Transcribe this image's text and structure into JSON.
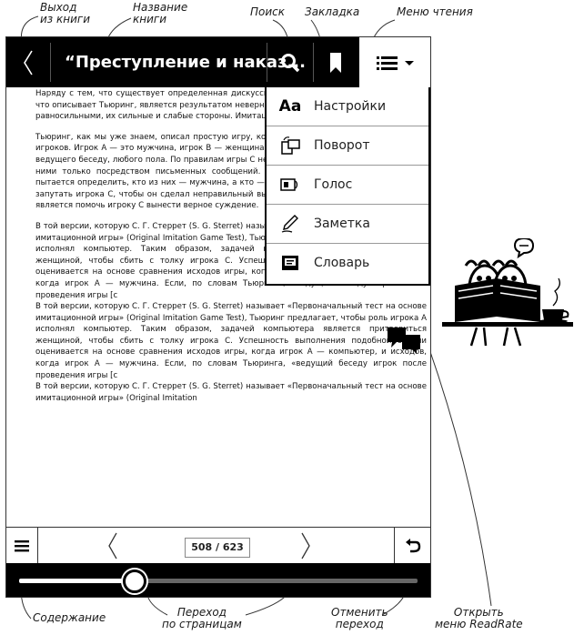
{
  "annotations": {
    "exit": "Выход\nиз книги",
    "title": "Название\nкниги",
    "search": "Поиск",
    "bookmark": "Закладка",
    "reading_menu": "Меню чтения",
    "contents": "Содержание",
    "page_nav": "Переход\nпо страницам",
    "undo": "Отменить\nпереход",
    "readrate": "Открыть\nменю ReadRate"
  },
  "header": {
    "book_title": "“Преступление и наказ..."
  },
  "reading_menu": {
    "items": [
      {
        "label": "Настройки",
        "icon": "font-settings-icon"
      },
      {
        "label": "Поворот",
        "icon": "rotate-icon"
      },
      {
        "label": "Голос",
        "icon": "voice-icon"
      },
      {
        "label": "Заметка",
        "icon": "pencil-icon"
      },
      {
        "label": "Словарь",
        "icon": "dictionary-icon"
      }
    ]
  },
  "body_text": {
    "p1": "Наряду с тем, что существует определенная дискуссия, современная интерпретация тому, что описывает Тьюринг, является результатом неверного толкования его работы, считаются равносильными, их сильные и слабые стороны. Имитационная игра",
    "p2": "Тьюринг, как мы уже знаем, описал простую игру, которая включает в себя минимум трех игроков. Игрок А — это мужчина, игрок В — женщина и игрок С, который играет в качестве ведущего беседу, любого пола. По правилам игры С не видит ни А, ни В и может общаться с ними только посредством письменных сообщений. Задавая вопросы игрокам А и В, С пытается определить, кто из них — мужчина, а кто — женщина. Задачей игрока А является запутать игрока С, чтобы он сделал неправильный вывод. В то же время задачей игрока В является помочь игроку С вынести верное суждение.",
    "p3": "В той версии, которую С. Г. Стеррет (S. G. Sterret) называет «Первоначальный тест на основе имитационной игры» (Original Imitation Game Test), Тьюринг предлагает, чтобы роль игрока А исполнял компьютер. Таким образом, задачей компьютера является притвориться женщиной, чтобы сбить с толку игрока С. Успешность выполнения подобной задачи оценивается на основе сравнения исходов игры, когда игрок А — компьютер, и исходов, когда игрок А — мужчина. Если, по словам Тьюринга, «ведущий беседу игрок после проведения игры [с",
    "p4": "В той версии, которую С. Г. Стеррет (S. G. Sterret) называет «Первоначальный тест на основе имитационной игры» (Original Imitation Game Test), Тьюринг предлагает, чтобы роль игрока А исполнял компьютер. Таким образом, задачей компьютера является притвориться женщиной, чтобы сбить с толку игрока С. Успешность выполнения подобной задачи оценивается на основе сравнения исходов игры, когда игрок А — компьютер, и исходов, когда игрок А — мужчина. Если, по словам Тьюринга, «ведущий беседу игрок после проведения игры [с",
    "p5": "В той версии, которую С. Г. Стеррет (S. G. Sterret) называет «Первоначальный тест на основе имитационной игры» (Original Imitation"
  },
  "footer": {
    "page_indicator": "508 / 623",
    "progress": 0.29
  },
  "colors": {
    "bar_bg": "#000000",
    "text": "#111111"
  }
}
